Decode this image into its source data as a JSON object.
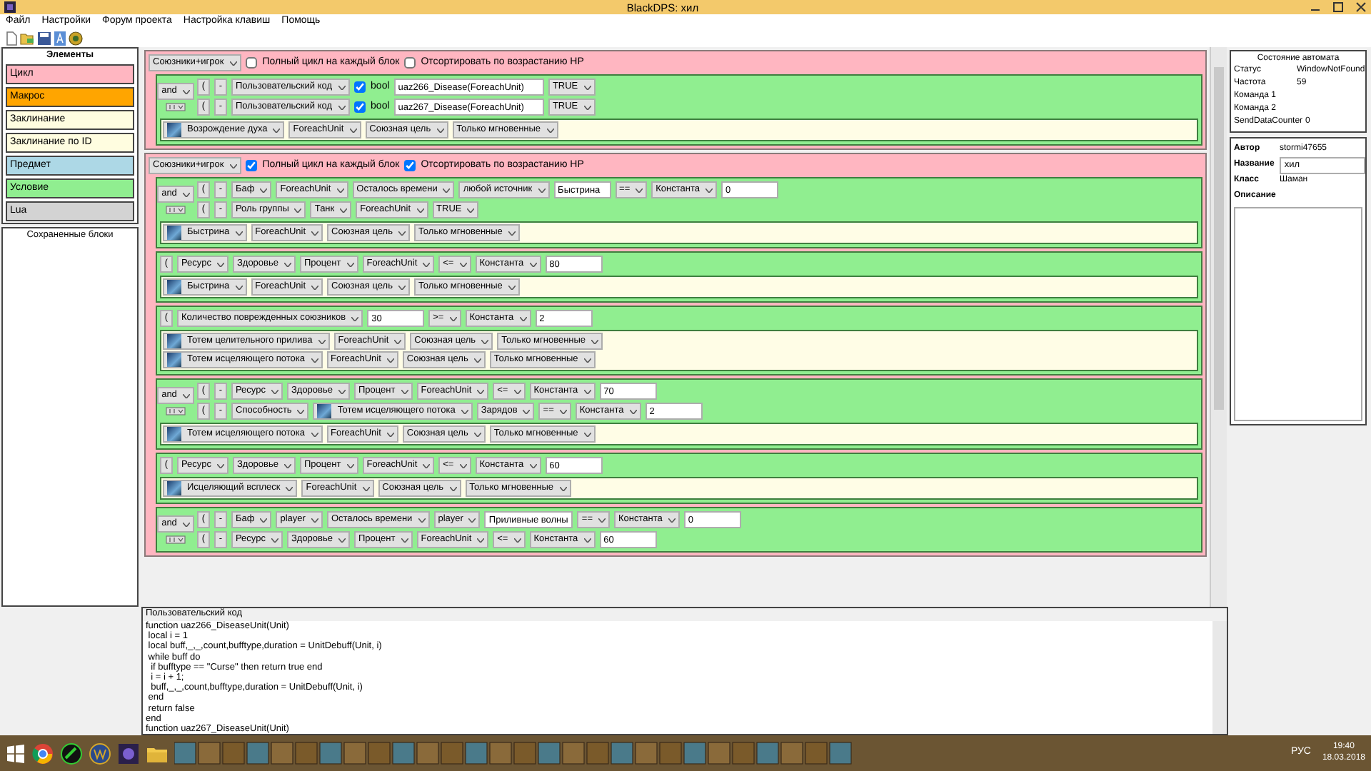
{
  "window": {
    "title": "BlackDPS: хил"
  },
  "menu": [
    "Файл",
    "Настройки",
    "Форум проекта",
    "Настройка клавиш",
    "Помощь"
  ],
  "elements_panel": {
    "title": "Элементы",
    "items": [
      {
        "label": "Цикл",
        "color": "#ffb6c1"
      },
      {
        "label": "Макрос",
        "color": "#ffa500"
      },
      {
        "label": "Заклинание",
        "color": "#fffde0"
      },
      {
        "label": "Заклинание по ID",
        "color": "#fffde0"
      },
      {
        "label": "Предмет",
        "color": "#add8e6"
      },
      {
        "label": "Условие",
        "color": "#90ee90"
      },
      {
        "label": "Lua",
        "color": "#d3d3d3"
      }
    ]
  },
  "saved_blocks": {
    "title": "Сохраненные блоки"
  },
  "sections": [
    {
      "target": "Союзники+игрок",
      "options": [
        {
          "label": "Полный цикл на каждый блок",
          "checked": false
        },
        {
          "label": "Отсортировать по возрастанию HP",
          "checked": false
        }
      ],
      "groups": [
        {
          "logic": "and",
          "conditions": [
            {
              "buttons": [
                "(",
                "-"
              ],
              "parts": [
                {
                  "kind": "select",
                  "text": "Пользовательский код"
                },
                {
                  "kind": "bool",
                  "label": "bool",
                  "checked": true
                },
                {
                  "kind": "input",
                  "value": "uaz266_Disease(ForeachUnit)"
                },
                {
                  "kind": "select",
                  "text": "TRUE"
                }
              ]
            },
            {
              "buttons": [
                "(",
                "-"
              ],
              "parts": [
                {
                  "kind": "select",
                  "text": "Пользовательский код"
                },
                {
                  "kind": "bool",
                  "label": "bool",
                  "checked": true
                },
                {
                  "kind": "input",
                  "value": "uaz267_Disease(ForeachUnit)"
                },
                {
                  "kind": "select",
                  "text": "TRUE"
                }
              ]
            }
          ],
          "actions": [
            {
              "parts": [
                {
                  "kind": "spell",
                  "text": "Возрождение духа"
                },
                {
                  "kind": "select",
                  "text": "ForeachUnit"
                },
                {
                  "kind": "select",
                  "text": "Союзная цель"
                },
                {
                  "kind": "select",
                  "text": "Только мгновенные"
                }
              ]
            }
          ]
        }
      ]
    },
    {
      "target": "Союзники+игрок",
      "options": [
        {
          "label": "Полный цикл на каждый блок",
          "checked": true
        },
        {
          "label": "Отсортировать по возрастанию HP",
          "checked": true
        }
      ],
      "groups": [
        {
          "logic": "and",
          "conditions": [
            {
              "buttons": [
                "(",
                "-"
              ],
              "parts": [
                {
                  "kind": "select",
                  "text": "Баф"
                },
                {
                  "kind": "select",
                  "text": "ForeachUnit"
                },
                {
                  "kind": "select",
                  "text": "Осталось времени"
                },
                {
                  "kind": "select",
                  "text": "любой источник"
                },
                {
                  "kind": "input",
                  "value": "Быстрина"
                },
                {
                  "kind": "select",
                  "text": "=="
                },
                {
                  "kind": "select",
                  "text": "Константа"
                },
                {
                  "kind": "input",
                  "value": "0"
                }
              ]
            },
            {
              "buttons": [
                "(",
                "-"
              ],
              "parts": [
                {
                  "kind": "select",
                  "text": "Роль группы"
                },
                {
                  "kind": "select",
                  "text": "Танк"
                },
                {
                  "kind": "select",
                  "text": "ForeachUnit"
                },
                {
                  "kind": "select",
                  "text": "TRUE"
                }
              ]
            }
          ],
          "actions": [
            {
              "parts": [
                {
                  "kind": "spell",
                  "text": "Быстрина"
                },
                {
                  "kind": "select",
                  "text": "ForeachUnit"
                },
                {
                  "kind": "select",
                  "text": "Союзная цель"
                },
                {
                  "kind": "select",
                  "text": "Только мгновенные"
                }
              ]
            }
          ]
        },
        {
          "conditions": [
            {
              "buttons": [
                "("
              ],
              "parts": [
                {
                  "kind": "select",
                  "text": "Ресурс"
                },
                {
                  "kind": "select",
                  "text": "Здоровье"
                },
                {
                  "kind": "select",
                  "text": "Процент"
                },
                {
                  "kind": "select",
                  "text": "ForeachUnit"
                },
                {
                  "kind": "select",
                  "text": "<="
                },
                {
                  "kind": "select",
                  "text": "Константа"
                },
                {
                  "kind": "input",
                  "value": "80"
                }
              ]
            }
          ],
          "actions": [
            {
              "parts": [
                {
                  "kind": "spell",
                  "text": "Быстрина"
                },
                {
                  "kind": "select",
                  "text": "ForeachUnit"
                },
                {
                  "kind": "select",
                  "text": "Союзная цель"
                },
                {
                  "kind": "select",
                  "text": "Только мгновенные"
                }
              ]
            }
          ]
        },
        {
          "conditions": [
            {
              "buttons": [
                "("
              ],
              "parts": [
                {
                  "kind": "select",
                  "text": "Количество поврежденных союзников"
                },
                {
                  "kind": "input",
                  "value": "30"
                },
                {
                  "kind": "select",
                  "text": ">="
                },
                {
                  "kind": "select",
                  "text": "Константа"
                },
                {
                  "kind": "input",
                  "value": "2"
                }
              ]
            }
          ],
          "actions": [
            {
              "parts": [
                {
                  "kind": "spell",
                  "text": "Тотем целительного прилива"
                },
                {
                  "kind": "select",
                  "text": "ForeachUnit"
                },
                {
                  "kind": "select",
                  "text": "Союзная цель"
                },
                {
                  "kind": "select",
                  "text": "Только мгновенные"
                }
              ]
            },
            {
              "parts": [
                {
                  "kind": "spell",
                  "text": "Тотем исцеляющего потока"
                },
                {
                  "kind": "select",
                  "text": "ForeachUnit"
                },
                {
                  "kind": "select",
                  "text": "Союзная цель"
                },
                {
                  "kind": "select",
                  "text": "Только мгновенные"
                }
              ]
            }
          ]
        },
        {
          "logic": "and",
          "conditions": [
            {
              "buttons": [
                "(",
                "-"
              ],
              "parts": [
                {
                  "kind": "select",
                  "text": "Ресурс"
                },
                {
                  "kind": "select",
                  "text": "Здоровье"
                },
                {
                  "kind": "select",
                  "text": "Процент"
                },
                {
                  "kind": "select",
                  "text": "ForeachUnit"
                },
                {
                  "kind": "select",
                  "text": "<="
                },
                {
                  "kind": "select",
                  "text": "Константа"
                },
                {
                  "kind": "input",
                  "value": "70"
                }
              ]
            },
            {
              "buttons": [
                "(",
                "-"
              ],
              "parts": [
                {
                  "kind": "select",
                  "text": "Способность"
                },
                {
                  "kind": "spell",
                  "text": "Тотем исцеляющего потока"
                },
                {
                  "kind": "select",
                  "text": "Зарядов"
                },
                {
                  "kind": "select",
                  "text": "=="
                },
                {
                  "kind": "select",
                  "text": "Константа"
                },
                {
                  "kind": "input",
                  "value": "2"
                }
              ]
            }
          ],
          "actions": [
            {
              "parts": [
                {
                  "kind": "spell",
                  "text": "Тотем исцеляющего потока"
                },
                {
                  "kind": "select",
                  "text": "ForeachUnit"
                },
                {
                  "kind": "select",
                  "text": "Союзная цель"
                },
                {
                  "kind": "select",
                  "text": "Только мгновенные"
                }
              ]
            }
          ]
        },
        {
          "conditions": [
            {
              "buttons": [
                "("
              ],
              "parts": [
                {
                  "kind": "select",
                  "text": "Ресурс"
                },
                {
                  "kind": "select",
                  "text": "Здоровье"
                },
                {
                  "kind": "select",
                  "text": "Процент"
                },
                {
                  "kind": "select",
                  "text": "ForeachUnit"
                },
                {
                  "kind": "select",
                  "text": "<="
                },
                {
                  "kind": "select",
                  "text": "Константа"
                },
                {
                  "kind": "input",
                  "value": "60"
                }
              ]
            }
          ],
          "actions": [
            {
              "parts": [
                {
                  "kind": "spell",
                  "text": "Исцеляющий всплеск"
                },
                {
                  "kind": "select",
                  "text": "ForeachUnit"
                },
                {
                  "kind": "select",
                  "text": "Союзная цель"
                },
                {
                  "kind": "select",
                  "text": "Только мгновенные"
                }
              ]
            }
          ]
        },
        {
          "logic": "and",
          "conditions": [
            {
              "buttons": [
                "(",
                "-"
              ],
              "parts": [
                {
                  "kind": "select",
                  "text": "Баф"
                },
                {
                  "kind": "select",
                  "text": "player"
                },
                {
                  "kind": "select",
                  "text": "Осталось времени"
                },
                {
                  "kind": "select",
                  "text": "player"
                },
                {
                  "kind": "input",
                  "value": "Приливные волны"
                },
                {
                  "kind": "select",
                  "text": "=="
                },
                {
                  "kind": "select",
                  "text": "Константа"
                },
                {
                  "kind": "input",
                  "value": "0"
                }
              ]
            },
            {
              "buttons": [
                "(",
                "-"
              ],
              "parts": [
                {
                  "kind": "select",
                  "text": "Ресурс"
                },
                {
                  "kind": "select",
                  "text": "Здоровье"
                },
                {
                  "kind": "select",
                  "text": "Процент"
                },
                {
                  "kind": "select",
                  "text": "ForeachUnit"
                },
                {
                  "kind": "select",
                  "text": "<="
                },
                {
                  "kind": "select",
                  "text": "Константа"
                },
                {
                  "kind": "input",
                  "value": "60"
                }
              ]
            }
          ]
        }
      ]
    }
  ],
  "code_panel": {
    "title": "Пользовательский код",
    "lines": [
      "function uaz266_DiseaseUnit(Unit)",
      " local i = 1",
      " local buff,_,_,count,bufftype,duration = UnitDebuff(Unit, i)",
      " while buff do",
      "  if bufftype == \"Curse\" then return true end",
      "  i = i + 1;",
      "  buff,_,_,count,bufftype,duration = UnitDebuff(Unit, i)",
      " end",
      " return false",
      "end",
      "function uaz267_DiseaseUnit(Unit)"
    ]
  },
  "automaton": {
    "title": "Состояние автомата",
    "rows": [
      {
        "label": "Статус",
        "value": "WindowNotFound"
      },
      {
        "label": "Частота",
        "value": "59"
      },
      {
        "label": "Команда 1"
      },
      {
        "label": "Команда 2"
      },
      {
        "label": "SendDataCounter",
        "value": "0"
      }
    ]
  },
  "profile": {
    "author_label": "Автор",
    "author": "stormi47655",
    "name_label": "Название",
    "name": "хил",
    "class_label": "Класс",
    "class": "Шаман",
    "description_label": "Описание"
  },
  "taskbar": {
    "language": "РУС",
    "time": "19:40",
    "date": "18.03.2018"
  }
}
